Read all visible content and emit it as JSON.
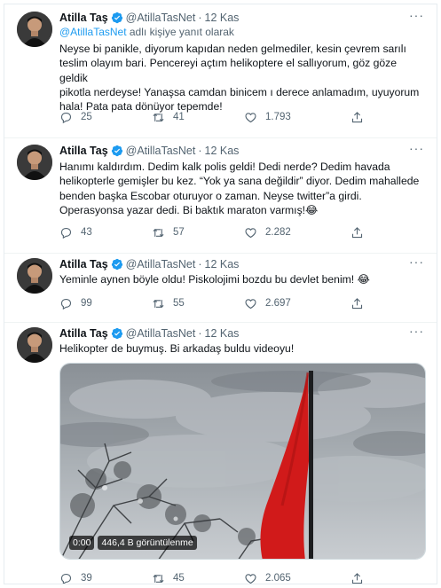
{
  "colors": {
    "accent": "#1d9bf0",
    "muted": "#536471",
    "flag": "#d11a1a"
  },
  "tweets": [
    {
      "name": "Atilla Taş",
      "handle": "@AtillaTasNet",
      "dot": "·",
      "time": "12 Kas",
      "reply_handle": "@AtillaTasNet",
      "reply_suffix": " adlı kişiye yanıt olarak",
      "lines": [
        "Neyse bi panikle, diyorum kapıdan neden gelmediler, kesin çevrem sarılı",
        "teslim olayım bari. Pencereyi açtım helikoptere el sallıyorum, göz göze geldik",
        "pikotla nerdeyse! Yanaşsa camdan binicem ı derece anlamadım, uyuyorum",
        "hala! Pata pata dönüyor tepemde!"
      ],
      "replies": "25",
      "retweets": "41",
      "likes": "1.793"
    },
    {
      "name": "Atilla Taş",
      "handle": "@AtillaTasNet",
      "dot": "·",
      "time": "12 Kas",
      "lines": [
        "Hanımı kaldırdım. Dedim kalk polis geldi! Dedi nerde? Dedim havada",
        "helikopterle gemişler bu kez. “Yok ya sana değildir” diyor. Dedim mahallede",
        "benden başka Escobar oturuyor o zaman. Neyse twitter”a girdi.",
        "Operasyonsa yazar dedi. Bi baktık maraton varmış!😂"
      ],
      "replies": "43",
      "retweets": "57",
      "likes": "2.282"
    },
    {
      "name": "Atilla Taş",
      "handle": "@AtillaTasNet",
      "dot": "·",
      "time": "12 Kas",
      "lines": [
        "Yeminle aynen böyle oldu! Piskolojimi bozdu bu devlet benim! 😂"
      ],
      "replies": "99",
      "retweets": "55",
      "likes": "2.697"
    },
    {
      "name": "Atilla Taş",
      "handle": "@AtillaTasNet",
      "dot": "·",
      "time": "12 Kas",
      "lines": [
        "Helikopter de buymuş. Bi arkadaş buldu videoyu!"
      ],
      "video_time": "0:00",
      "video_views": "446,4 B görüntülenme",
      "replies": "39",
      "retweets": "45",
      "likes": "2.065"
    }
  ],
  "icons": [
    "verified-badge-icon",
    "more-icon",
    "reply-icon",
    "retweet-icon",
    "like-icon",
    "share-icon"
  ]
}
